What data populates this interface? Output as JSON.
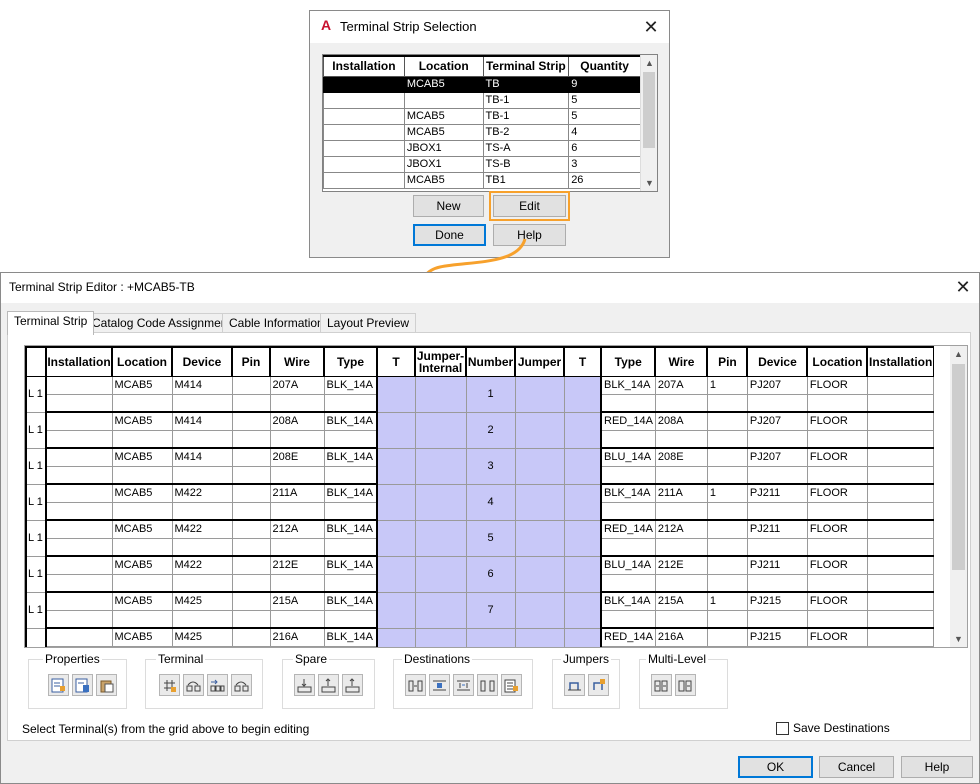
{
  "selection_dialog": {
    "title": "Terminal Strip Selection",
    "columns": [
      "Installation",
      "Location",
      "Terminal Strip",
      "Quantity"
    ],
    "rows": [
      [
        "",
        "MCAB5",
        "TB",
        "9"
      ],
      [
        "",
        "",
        "TB-1",
        "5"
      ],
      [
        "",
        "MCAB5",
        "TB-1",
        "5"
      ],
      [
        "",
        "MCAB5",
        "TB-2",
        "4"
      ],
      [
        "",
        "JBOX1",
        "TS-A",
        "6"
      ],
      [
        "",
        "JBOX1",
        "TS-B",
        "3"
      ],
      [
        "",
        "MCAB5",
        "TB1",
        "26"
      ]
    ],
    "buttons": {
      "new": "New",
      "edit": "Edit",
      "done": "Done",
      "help": "Help"
    }
  },
  "editor": {
    "title": "Terminal Strip Editor : +MCAB5-TB",
    "tabs": [
      "Terminal Strip",
      "Catalog Code Assignment",
      "Cable Information",
      "Layout Preview"
    ],
    "grid_columns": [
      "Installation",
      "Location",
      "Device",
      "Pin",
      "Wire",
      "Type",
      "T",
      "Jumper-Internal",
      "Number",
      "Jumper",
      "T",
      "Type",
      "Wire",
      "Pin",
      "Device",
      "Location",
      "Installation"
    ],
    "rows": [
      {
        "level": "L 1",
        "l_install": "",
        "l_loc": "MCAB5",
        "l_dev": "M414",
        "l_pin": "",
        "l_wire": "207A",
        "l_type": "BLK_14A",
        "number": "1",
        "r_type": "BLK_14A",
        "r_wire": "207A",
        "r_pin": "1",
        "r_dev": "PJ207",
        "r_loc": "FLOOR",
        "r_install": ""
      },
      {
        "level": "L 1",
        "l_install": "",
        "l_loc": "MCAB5",
        "l_dev": "M414",
        "l_pin": "",
        "l_wire": "208A",
        "l_type": "BLK_14A",
        "number": "2",
        "r_type": "RED_14A",
        "r_wire": "208A",
        "r_pin": "",
        "r_dev": "PJ207",
        "r_loc": "FLOOR",
        "r_install": ""
      },
      {
        "level": "L 1",
        "l_install": "",
        "l_loc": "MCAB5",
        "l_dev": "M414",
        "l_pin": "",
        "l_wire": "208E",
        "l_type": "BLK_14A",
        "number": "3",
        "r_type": "BLU_14A",
        "r_wire": "208E",
        "r_pin": "",
        "r_dev": "PJ207",
        "r_loc": "FLOOR",
        "r_install": ""
      },
      {
        "level": "L 1",
        "l_install": "",
        "l_loc": "MCAB5",
        "l_dev": "M422",
        "l_pin": "",
        "l_wire": "211A",
        "l_type": "BLK_14A",
        "number": "4",
        "r_type": "BLK_14A",
        "r_wire": "211A",
        "r_pin": "1",
        "r_dev": "PJ211",
        "r_loc": "FLOOR",
        "r_install": ""
      },
      {
        "level": "L 1",
        "l_install": "",
        "l_loc": "MCAB5",
        "l_dev": "M422",
        "l_pin": "",
        "l_wire": "212A",
        "l_type": "BLK_14A",
        "number": "5",
        "r_type": "RED_14A",
        "r_wire": "212A",
        "r_pin": "",
        "r_dev": "PJ211",
        "r_loc": "FLOOR",
        "r_install": ""
      },
      {
        "level": "L 1",
        "l_install": "",
        "l_loc": "MCAB5",
        "l_dev": "M422",
        "l_pin": "",
        "l_wire": "212E",
        "l_type": "BLK_14A",
        "number": "6",
        "r_type": "BLU_14A",
        "r_wire": "212E",
        "r_pin": "",
        "r_dev": "PJ211",
        "r_loc": "FLOOR",
        "r_install": ""
      },
      {
        "level": "L 1",
        "l_install": "",
        "l_loc": "MCAB5",
        "l_dev": "M425",
        "l_pin": "",
        "l_wire": "215A",
        "l_type": "BLK_14A",
        "number": "7",
        "r_type": "BLK_14A",
        "r_wire": "215A",
        "r_pin": "1",
        "r_dev": "PJ215",
        "r_loc": "FLOOR",
        "r_install": ""
      },
      {
        "level": "",
        "l_install": "",
        "l_loc": "MCAB5",
        "l_dev": "M425",
        "l_pin": "",
        "l_wire": "216A",
        "l_type": "BLK_14A",
        "number": "",
        "r_type": "RED_14A",
        "r_wire": "216A",
        "r_pin": "",
        "r_dev": "PJ215",
        "r_loc": "FLOOR",
        "r_install": ""
      }
    ],
    "groups": {
      "properties": "Properties",
      "terminal": "Terminal",
      "spare": "Spare",
      "destinations": "Destinations",
      "jumpers": "Jumpers",
      "multilevel": "Multi-Level"
    },
    "hint": "Select Terminal(s) from the grid above to begin editing",
    "save_destinations": "Save Destinations",
    "buttons": {
      "ok": "OK",
      "cancel": "Cancel",
      "help": "Help"
    }
  },
  "colors": {
    "highlight": "#c8c8f8",
    "edit_outline": "#f7a12c",
    "focus": "#0078d7",
    "app_icon": "#c8102e"
  }
}
